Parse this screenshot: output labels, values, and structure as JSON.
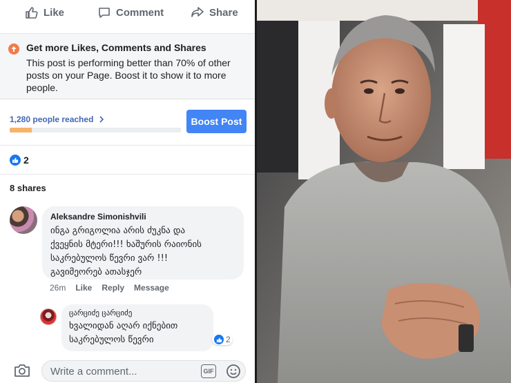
{
  "actions": {
    "like_label": "Like",
    "comment_label": "Comment",
    "share_label": "Share"
  },
  "boost_prompt": {
    "title": "Get more Likes, Comments and Shares",
    "body": "This post is performing better than 70% of other posts on your Page. Boost it to show it to more people.",
    "icon": "arrow-up-icon",
    "accent": "#f07c4a"
  },
  "reach": {
    "label": "1,280 people reached",
    "progress_percent": 13,
    "boost_button": "Boost Post",
    "button_color": "#4285f4"
  },
  "reactions": {
    "like_count": "2"
  },
  "shares_label": "8 shares",
  "comments": [
    {
      "author": "Aleksandre Simonishvili",
      "text_lines": [
        "ინგა გრიგოლია არის ძუკნა და",
        "ქვეყნის მტერი!!! ხაშურის რაიონის",
        "საკრებულოს წევრი ვარ !!!",
        "გავიმეორებ ათასჯერ"
      ],
      "time": "26m",
      "like_action": "Like",
      "reply_action": "Reply",
      "message_action": "Message"
    }
  ],
  "reply": {
    "author": "ცარციძე ცარციძე",
    "text_lines": [
      "ხვალიდან აღარ იქნებით",
      "საკრებულოს წევრი"
    ],
    "like_count": "2"
  },
  "composer": {
    "placeholder": "Write a comment...",
    "gif_label": "GIF"
  },
  "photo": {
    "background": "#6e6a66"
  }
}
